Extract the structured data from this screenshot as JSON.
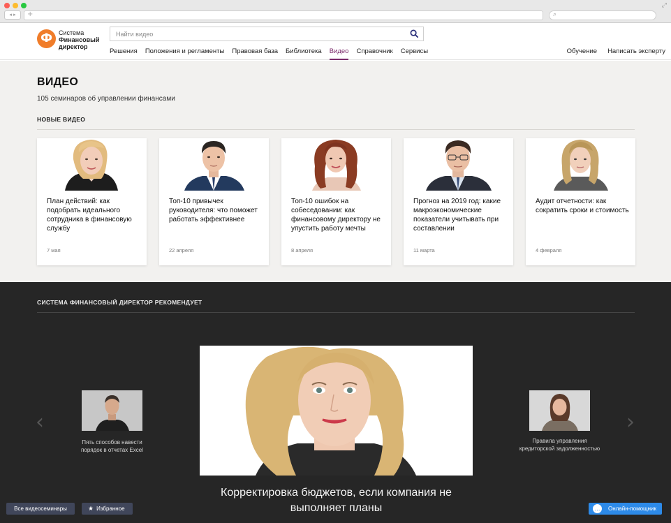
{
  "browser": {
    "back_forward": "◂ ▸",
    "new_tab": "+",
    "search_icon": "search-icon",
    "resize_icon": "expand-icon"
  },
  "header": {
    "logo": {
      "mark": "Ф",
      "line1": "Система",
      "line2": "Финансовый",
      "line3": "директор",
      "color": "#f07d2a"
    },
    "search": {
      "placeholder": "Найти видео",
      "value": ""
    },
    "nav": [
      {
        "label": "Решения"
      },
      {
        "label": "Положения и регламенты"
      },
      {
        "label": "Правовая база"
      },
      {
        "label": "Библиотека"
      },
      {
        "label": "Видео"
      },
      {
        "label": "Справочник"
      },
      {
        "label": "Сервисы"
      }
    ],
    "active_nav": "Видео",
    "active_color": "#7a2a6a",
    "nav_right": [
      {
        "label": "Обучение"
      },
      {
        "label": "Написать эксперту"
      }
    ]
  },
  "page": {
    "title": "ВИДЕО",
    "subtitle": "105 семинаров об управлении финансами",
    "new_videos_label": "НОВЫЕ ВИДЕО"
  },
  "cards": [
    {
      "title": "План действий: как подобрать идеального сотрудника в финансовую службу",
      "date": "7 мая"
    },
    {
      "title": "Топ-10 привычек руководителя: что поможет работать эффективнее",
      "date": "22 апреля"
    },
    {
      "title": "Топ-10 ошибок на собеседовании: как финансовому директору не упустить работу мечты",
      "date": "8 апреля"
    },
    {
      "title": "Прогноз на 2019 год: какие макроэкономические показатели учитывать при составлении",
      "date": "11 марта"
    },
    {
      "title": "Аудит отчетности: как сократить сроки и стоимость",
      "date": "4 февраля"
    }
  ],
  "recommends": {
    "label": "СИСТЕМА ФИНАНСОВЫЙ ДИРЕКТОР РЕКОМЕНДУЕТ",
    "main_caption": "Корректировка бюджетов, если компания не выполняет планы",
    "left": {
      "caption": "Пять способов навести порядок в отчетах Excel"
    },
    "right": {
      "caption": "Правила управления кредиторской задолженностью"
    },
    "prev_arrow": "‹",
    "next_arrow": "›"
  },
  "footer": {
    "all_seminars": "Все видеосеминары",
    "favorites": "Избранное",
    "favorites_icon": "★",
    "chat": "Онлайн-помощник",
    "chat_icon": "…",
    "chat_color": "#2d8ae8"
  }
}
